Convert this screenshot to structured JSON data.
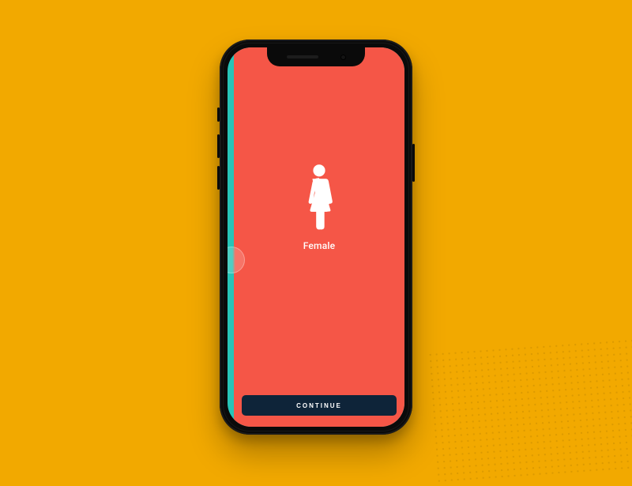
{
  "colors": {
    "canvas": "#f2a900",
    "panel": "#f55647",
    "accent_teal": "#27c4b8",
    "button_bg": "#0e2439",
    "text_on_panel": "#ffffff"
  },
  "gender": {
    "label": "Female",
    "icon": "female-icon"
  },
  "actions": {
    "continue_label": "CONTINUE"
  }
}
